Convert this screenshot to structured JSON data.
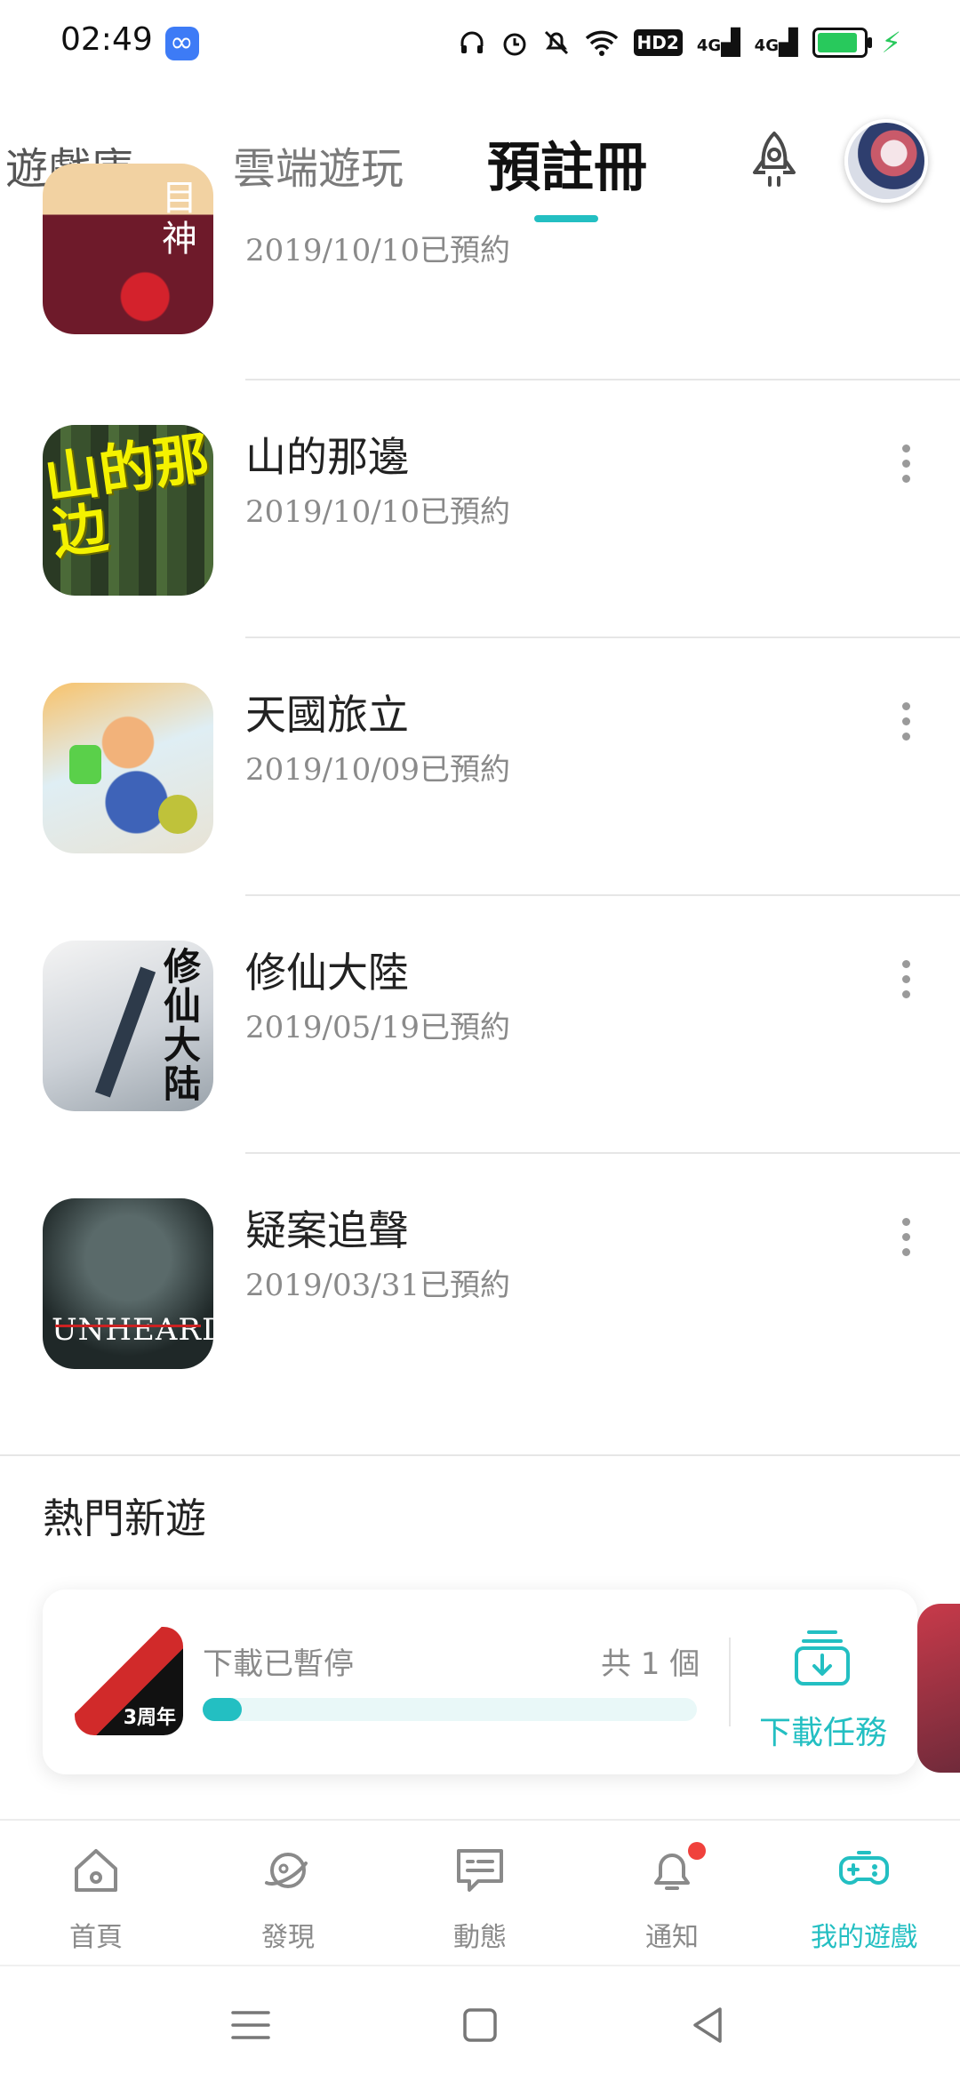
{
  "status_bar": {
    "time": "02:49",
    "icons": [
      "headphones-icon",
      "alarm-icon",
      "mute-icon",
      "wifi-icon",
      "hd-icon",
      "signal-4g-icon",
      "signal-4g-icon",
      "battery-icon",
      "charging-icon"
    ],
    "hd_label": "HD2",
    "net1": "4G",
    "net2": "4G"
  },
  "tabs": [
    {
      "label": "遊戲庫"
    },
    {
      "label": "雲端遊玩"
    },
    {
      "label": "預註冊",
      "active": true
    }
  ],
  "preorders": [
    {
      "name": "",
      "date": "2019/10/10已預約",
      "thumb_text": "目神"
    },
    {
      "name": "山的那邊",
      "date": "2019/10/10已預約",
      "thumb_text": "山的那边"
    },
    {
      "name": "天國旅立",
      "date": "2019/10/09已預約",
      "thumb_text": ""
    },
    {
      "name": "修仙大陸",
      "date": "2019/05/19已預約",
      "thumb_text": "修仙大陆"
    },
    {
      "name": "疑案追聲",
      "date": "2019/03/31已預約",
      "thumb_text": "UNHEARD"
    }
  ],
  "section": {
    "title": "熱門新遊"
  },
  "download": {
    "status": "下載已暫停",
    "count": "共 1 個",
    "progress": 0.08,
    "action_label": "下載任務",
    "thumb_tag": "3周年"
  },
  "bottom_nav": [
    {
      "label": "首頁",
      "icon": "home-icon"
    },
    {
      "label": "發現",
      "icon": "planet-icon"
    },
    {
      "label": "動態",
      "icon": "message-icon"
    },
    {
      "label": "通知",
      "icon": "bell-icon",
      "badge": true
    },
    {
      "label": "我的遊戲",
      "icon": "gamepad-icon",
      "active": true
    }
  ],
  "colors": {
    "accent": "#23bfc2",
    "badge": "#f0413c",
    "battery": "#28c95c"
  }
}
